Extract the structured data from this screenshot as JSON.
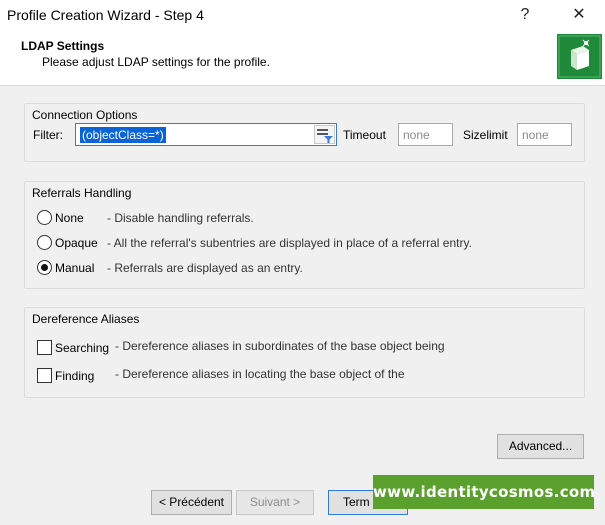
{
  "window": {
    "title": "Profile Creation Wizard - Step 4",
    "help_glyph": "?",
    "close_glyph": "✕"
  },
  "header": {
    "title": "LDAP Settings",
    "subtitle": "Please adjust LDAP settings for the profile."
  },
  "connection": {
    "legend": "Connection Options",
    "filter_label": "Filter:",
    "filter_value": "(objectClass=*)",
    "timeout_label": "Timeout",
    "timeout_value": "none",
    "sizelimit_label": "Sizelimit",
    "sizelimit_value": "none"
  },
  "referrals": {
    "legend": "Referrals Handling",
    "options": [
      {
        "label": "None",
        "description": "- Disable handling referrals.",
        "checked": false
      },
      {
        "label": "Opaque",
        "description": "- All the referral's subentries are displayed in place of a referral entry.",
        "checked": false
      },
      {
        "label": "Manual",
        "description": "- Referrals are displayed as an entry.",
        "checked": true
      }
    ]
  },
  "dereference": {
    "legend": "Dereference Aliases",
    "options": [
      {
        "label": "Searching",
        "description": "- Dereference aliases in subordinates of the base object being",
        "checked": false
      },
      {
        "label": "Finding",
        "description": "- Dereference aliases in locating the base object of the",
        "checked": false
      }
    ]
  },
  "buttons": {
    "advanced": "Advanced...",
    "previous": "< Précédent",
    "next": "Suivant >",
    "finish": "Term"
  },
  "banner": {
    "text": "www.identitycosmos.com",
    "color": "#5aa02c"
  },
  "colors": {
    "selection": "#0a64d6",
    "focus_border": "#2f7bd6",
    "logo": "#1f8a3a"
  }
}
